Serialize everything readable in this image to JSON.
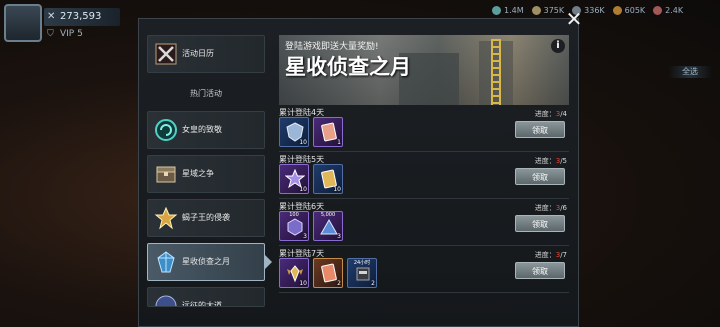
{
  "hud": {
    "power": "273,593",
    "vip": "VIP 5",
    "resources": [
      {
        "value": "1.4M",
        "color": "#6fc3c0"
      },
      {
        "value": "375K",
        "color": "#c2b07a"
      },
      {
        "value": "336K",
        "color": "#8a9ba8"
      },
      {
        "value": "605K",
        "color": "#d69a3c"
      },
      {
        "value": "2.4K",
        "color": "#c96a6a"
      }
    ],
    "side_label": "全选"
  },
  "close_label": "✕",
  "menu": {
    "calendar": "活动日历",
    "section_header": "热门活动",
    "items": [
      {
        "label": "女皇的致敬",
        "icon": "crown-swirl-icon"
      },
      {
        "label": "星域之争",
        "icon": "treasure-chest-icon"
      },
      {
        "label": "蝎子王的侵袭",
        "icon": "gold-medal-icon"
      },
      {
        "label": "星收侦查之月",
        "icon": "crystal-gem-icon",
        "active": true
      },
      {
        "label": "远征的大道",
        "icon": "globe-emblem-icon"
      }
    ]
  },
  "banner": {
    "subtitle": "登陆游戏即送大量奖励!",
    "title": "星收侦查之月",
    "info": "i"
  },
  "rewards": [
    {
      "day_label": "累计登陆4天",
      "progress_prefix": "进度：",
      "current": "3",
      "total": "/4",
      "claim": "领取",
      "items": [
        {
          "type": "blue",
          "qty": "10",
          "icon": "shield-badge-icon"
        },
        {
          "type": "purple",
          "qty": "1",
          "icon": "pink-card-icon"
        }
      ]
    },
    {
      "day_label": "累计登陆5天",
      "progress_prefix": "进度：",
      "current": "3",
      "total": "/5",
      "claim": "领取",
      "items": [
        {
          "type": "purple",
          "qty": "10",
          "icon": "star-badge-icon"
        },
        {
          "type": "blue",
          "qty": "10",
          "icon": "gold-card-icon"
        }
      ]
    },
    {
      "day_label": "累计登陆6天",
      "progress_prefix": "进度：",
      "current": "3",
      "total": "/6",
      "claim": "领取",
      "items": [
        {
          "type": "purple",
          "qty": "3",
          "top": "100",
          "icon": "hexagon-crate-icon"
        },
        {
          "type": "purple",
          "qty": "3",
          "top": "5,000",
          "icon": "triangle-crate-icon"
        }
      ]
    },
    {
      "day_label": "累计登陆7天",
      "progress_prefix": "进度：",
      "current": "3",
      "total": "/7",
      "claim": "领取",
      "items": [
        {
          "type": "purple",
          "qty": "10",
          "icon": "gold-wing-badge-icon"
        },
        {
          "type": "orange",
          "qty": "2",
          "icon": "orange-card-icon"
        },
        {
          "type": "blue",
          "qty": "2",
          "top": "24小时",
          "icon": "timer-crate-icon"
        }
      ]
    }
  ]
}
